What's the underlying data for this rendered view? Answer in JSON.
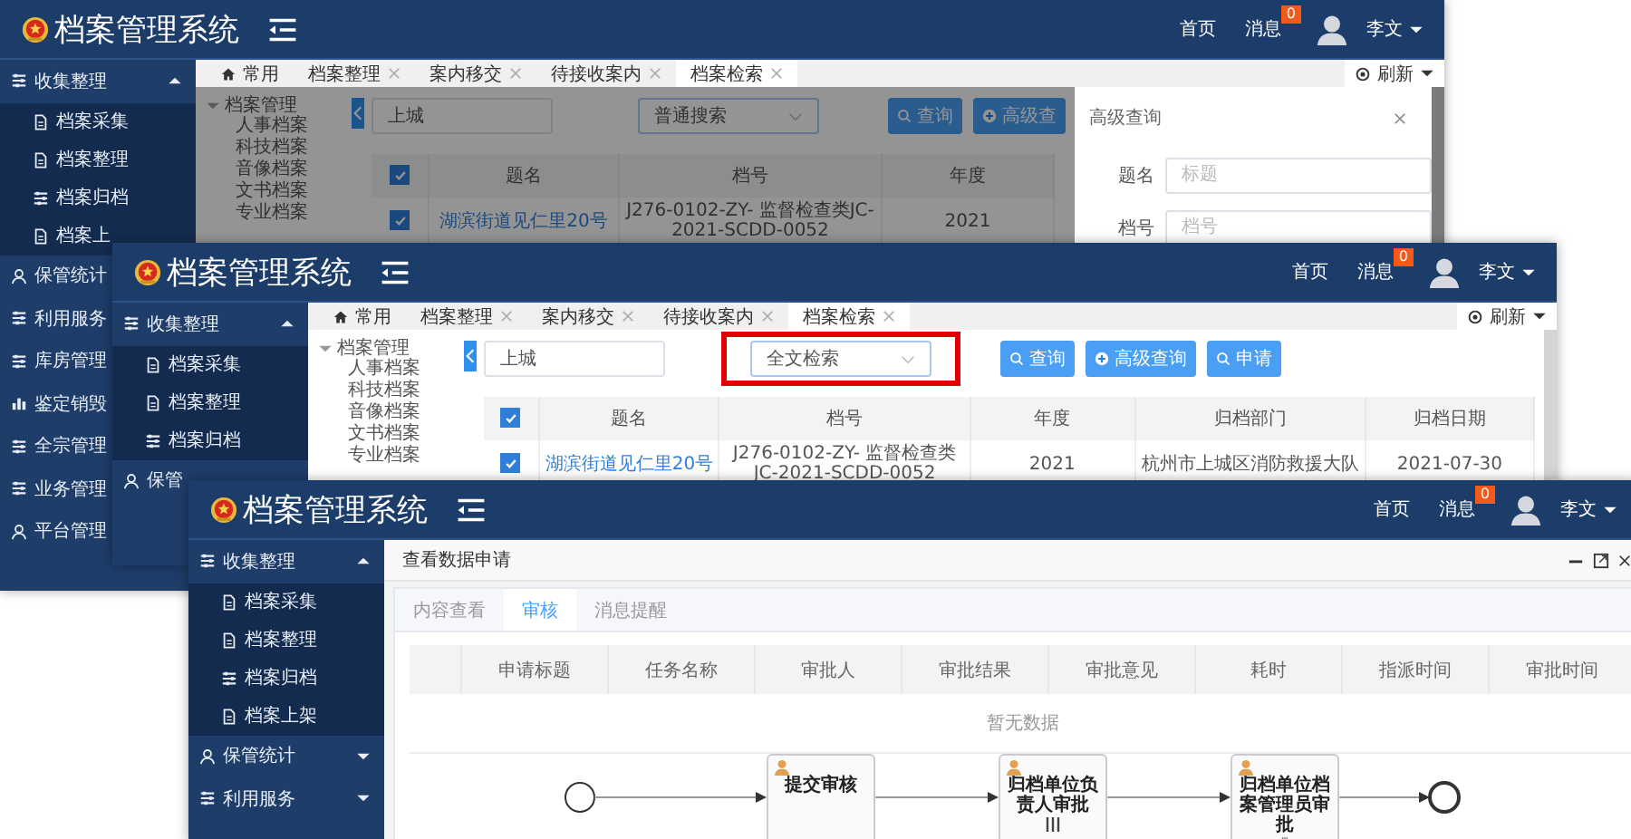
{
  "windows": [
    {
      "header": {
        "title": "档案管理系统",
        "links": [
          "首页",
          "消息"
        ],
        "badge": "0",
        "user": "李文"
      },
      "sidebar": [
        {
          "label": "收集整理",
          "kind": "list",
          "expanded": true,
          "children": [
            {
              "label": "档案采集",
              "kind": "file"
            },
            {
              "label": "档案整理",
              "kind": "file"
            },
            {
              "label": "档案归档",
              "kind": "list"
            },
            {
              "label": "档案上",
              "kind": "file"
            }
          ]
        },
        {
          "label": "保管统计",
          "kind": "user"
        },
        {
          "label": "利用服务",
          "kind": "list"
        },
        {
          "label": "库房管理",
          "kind": "list"
        },
        {
          "label": "鉴定销毁",
          "kind": "chart"
        },
        {
          "label": "全宗管理",
          "kind": "list"
        },
        {
          "label": "业务管理",
          "kind": "list"
        },
        {
          "label": "平台管理",
          "kind": "user"
        }
      ],
      "tabs": [
        {
          "label": "常用",
          "kind": "home",
          "selected": false
        },
        {
          "label": "档案整理",
          "selected": false
        },
        {
          "label": "案内移交",
          "selected": false
        },
        {
          "label": "待接收案内",
          "selected": false
        },
        {
          "label": "档案检索",
          "selected": true
        }
      ],
      "refresh": "刷新",
      "main": {
        "kind": "search",
        "tree": {
          "label": "档案管理",
          "expanded": true,
          "children": [
            "人事档案",
            "科技档案",
            "音像档案",
            "文书档案",
            "专业档案"
          ]
        },
        "search_field": {
          "value": "上城"
        },
        "scope_select": {
          "value": "普通搜索",
          "highlighted": false
        },
        "buttons": [
          {
            "label": "查询",
            "kind": "search"
          },
          {
            "label": "高级查",
            "kind": "plus"
          }
        ],
        "table": {
          "header_checked": true,
          "columns": [
            "题名",
            "档号",
            "年度"
          ],
          "rows": [
            {
              "checked": true,
              "cells": [
                "湖滨街道见仁里20号",
                "J276-0102-ZY- 监督检查类JC-2021-SCDD-0052",
                "2021"
              ]
            }
          ]
        },
        "dimmed": true,
        "drawer": {
          "title": "高级查询",
          "fields": [
            {
              "label": "题名",
              "placeholder": "标题"
            },
            {
              "label": "档号",
              "placeholder": "档号"
            }
          ]
        }
      }
    },
    {
      "header": {
        "title": "档案管理系统",
        "links": [
          "首页",
          "消息"
        ],
        "badge": "0",
        "user": "李文"
      },
      "sidebar": [
        {
          "label": "收集整理",
          "kind": "list",
          "expanded": true,
          "children": [
            {
              "label": "档案采集",
              "kind": "file"
            },
            {
              "label": "档案整理",
              "kind": "file"
            },
            {
              "label": "档案归档",
              "kind": "list"
            }
          ]
        },
        {
          "label": "保管",
          "kind": "user"
        }
      ],
      "tabs": [
        {
          "label": "常用",
          "kind": "home",
          "selected": false
        },
        {
          "label": "档案整理",
          "selected": false
        },
        {
          "label": "案内移交",
          "selected": false
        },
        {
          "label": "待接收案内",
          "selected": false
        },
        {
          "label": "档案检索",
          "selected": true
        }
      ],
      "refresh": "刷新",
      "main": {
        "kind": "search",
        "tree": {
          "label": "档案管理",
          "expanded": true,
          "children": [
            "人事档案",
            "科技档案",
            "音像档案",
            "文书档案",
            "专业档案"
          ]
        },
        "search_field": {
          "value": "上城"
        },
        "scope_select": {
          "value": "全文检索",
          "highlighted": true
        },
        "buttons": [
          {
            "label": "查询",
            "kind": "search"
          },
          {
            "label": "高级查询",
            "kind": "plus"
          },
          {
            "label": "申请",
            "kind": "search"
          }
        ],
        "table": {
          "header_checked": true,
          "columns": [
            "题名",
            "档号",
            "年度",
            "归档部门",
            "归档日期"
          ],
          "rows": [
            {
              "checked": true,
              "cells": [
                "湖滨街道见仁里20号",
                "J276-0102-ZY- 监督检查类JC-2021-SCDD-0052",
                "2021",
                "杭州市上城区消防救援大队",
                "2021-07-30"
              ]
            }
          ]
        }
      }
    },
    {
      "header": {
        "title": "档案管理系统",
        "links": [
          "首页",
          "消息"
        ],
        "badge": "0",
        "user": "李文"
      },
      "sidebar": [
        {
          "label": "收集整理",
          "kind": "list",
          "expanded": true,
          "children": [
            {
              "label": "档案采集",
              "kind": "file"
            },
            {
              "label": "档案整理",
              "kind": "file"
            },
            {
              "label": "档案归档",
              "kind": "list"
            },
            {
              "label": "档案上架",
              "kind": "file"
            }
          ]
        },
        {
          "label": "保管统计",
          "kind": "user",
          "expanded": false
        },
        {
          "label": "利用服务",
          "kind": "list",
          "expanded": false
        }
      ],
      "main": {
        "kind": "request",
        "title": "查看数据申请",
        "tabs": [
          {
            "label": "内容查看",
            "selected": false
          },
          {
            "label": "审核",
            "selected": true
          },
          {
            "label": "消息提醒",
            "selected": false
          }
        ],
        "table": {
          "columns": [
            "申请标题",
            "任务名称",
            "审批人",
            "审批结果",
            "审批意见",
            "耗时",
            "指派时间",
            "审批时间"
          ],
          "empty_text": "暂无数据"
        },
        "flow": {
          "nodes": [
            {
              "label": "提交审核",
              "kind": "task"
            },
            {
              "label": "归档单位负责人审批",
              "kind": "multi"
            },
            {
              "label": "归档单位档案管理员审批",
              "kind": "multi"
            }
          ]
        }
      }
    }
  ]
}
